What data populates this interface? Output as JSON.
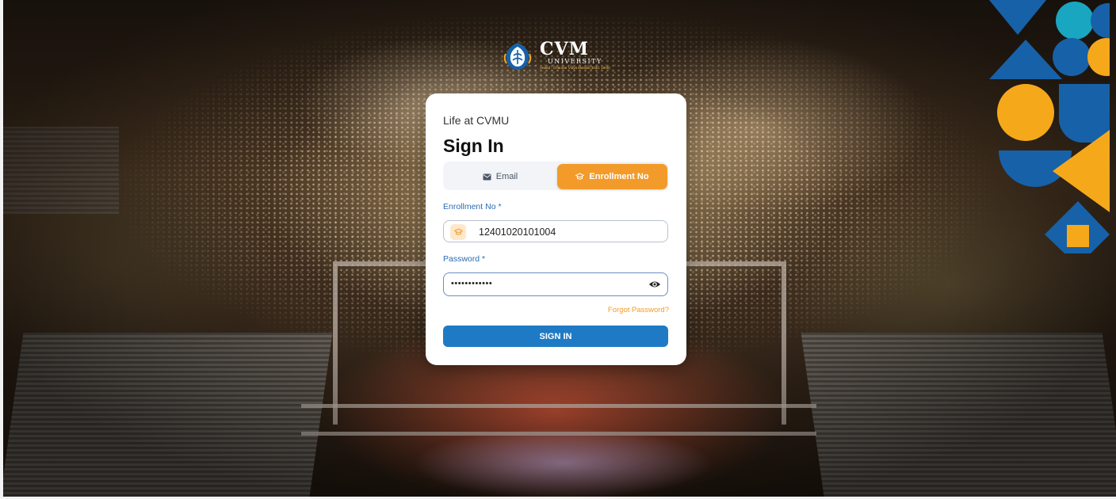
{
  "logo": {
    "name": "CVM",
    "subtitle": "UNIVERSITY",
    "tagline": "Anand - Charutar Vidya Mandal (Estd. 1945)"
  },
  "card": {
    "kicker": "Life at CVMU",
    "title": "Sign In"
  },
  "tabs": [
    {
      "label": "Email",
      "icon": "mail-icon",
      "active": false
    },
    {
      "label": "Enrollment No",
      "icon": "cap-icon",
      "active": true
    }
  ],
  "form": {
    "enrollment_label": "Enrollment No *",
    "enrollment_value": "12401020101004",
    "password_label": "Password *",
    "password_value": "••••••••••••",
    "forgot_label": "Forgot Password?",
    "submit_label": "SIGN IN"
  },
  "colors": {
    "accent_orange": "#f39b2a",
    "primary_blue": "#1e7ac4",
    "label_blue": "#2b6cb0",
    "deco_yellow": "#f6a81b",
    "deco_blue": "#1761a8",
    "deco_teal": "#19a6c1"
  }
}
